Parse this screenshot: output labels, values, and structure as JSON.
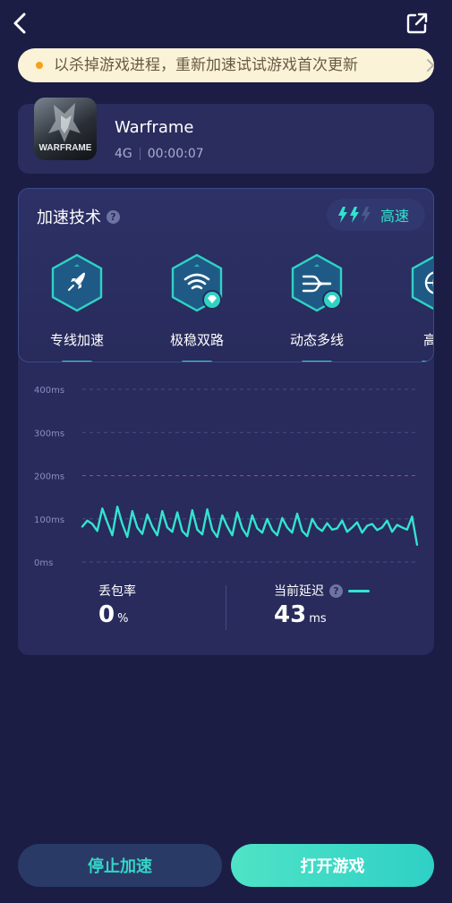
{
  "notice": {
    "text": "以杀掉游戏进程，重新加速试试游戏首次更新"
  },
  "game": {
    "name": "Warframe",
    "icon_label": "WARFRAME",
    "network": "4G",
    "elapsed": "00:00:07"
  },
  "tech": {
    "title": "加速技术",
    "speed_label": "高速",
    "features": [
      {
        "label": "专线加速",
        "icon": "rocket-icon",
        "premium": false
      },
      {
        "label": "极稳双路",
        "icon": "wifi-icon",
        "premium": true
      },
      {
        "label": "动态多线",
        "icon": "multiline-icon",
        "premium": true
      },
      {
        "label": "高速",
        "icon": "globe-icon",
        "premium": false
      }
    ]
  },
  "chart_data": {
    "type": "line",
    "y_tick_labels": [
      "400ms",
      "300ms",
      "200ms",
      "100ms",
      "0ms"
    ],
    "ylim": [
      0,
      400
    ],
    "threshold": 200,
    "threshold_color": "#e0334f",
    "line_color": "#33e3d0",
    "grid": true,
    "series": [
      {
        "values": [
          82,
          96,
          88,
          72,
          124,
          92,
          62,
          128,
          88,
          58,
          118,
          80,
          65,
          110,
          82,
          62,
          118,
          80,
          70,
          115,
          72,
          60,
          120,
          75,
          64,
          122,
          75,
          58,
          108,
          82,
          62,
          115,
          78,
          60,
          108,
          78,
          68,
          100,
          74,
          62,
          102,
          80,
          68,
          112,
          72,
          60,
          100,
          80,
          72,
          90,
          75,
          78,
          96,
          70,
          80,
          92,
          68,
          84,
          88,
          74,
          80,
          96,
          70,
          86,
          80,
          75,
          105,
          40
        ]
      }
    ]
  },
  "stats": {
    "loss_label": "丢包率",
    "loss_value": "0",
    "loss_unit": "%",
    "latency_label": "当前延迟",
    "latency_value": "43",
    "latency_unit": "ms"
  },
  "buttons": {
    "stop_label": "停止加速",
    "open_label": "打开游戏"
  }
}
